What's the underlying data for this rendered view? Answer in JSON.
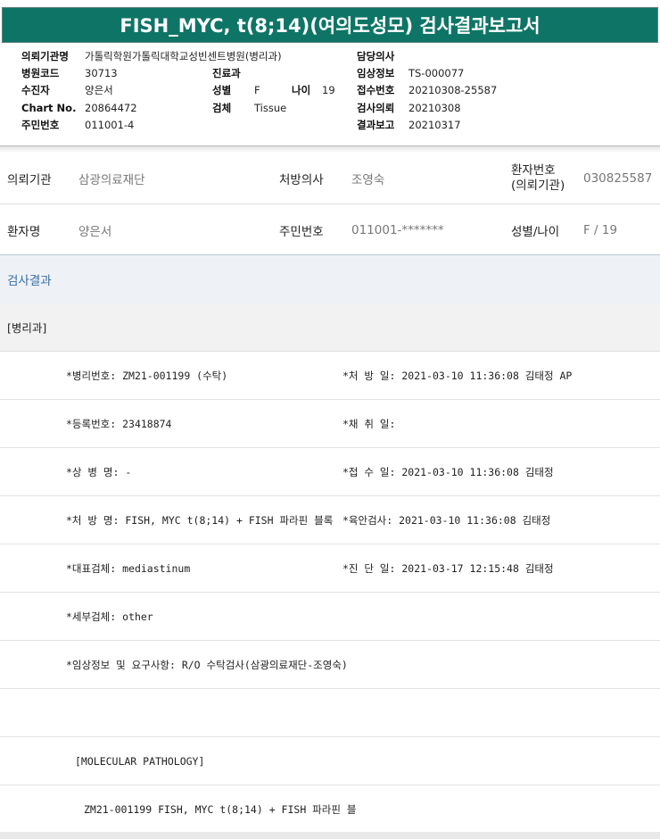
{
  "banner": {
    "title": "FISH_MYC, t(8;14)(여의도성모) 검사결과보고서"
  },
  "info": {
    "inst_label": "의뢰기관명",
    "inst_value": "가톨릭학원가톨릭대학교성빈센트병원(병리과)",
    "doctor_label": "담당의사",
    "doctor_value": "",
    "hosp_code_label": "병원코드",
    "hosp_code_value": "30713",
    "dept_label": "진료과",
    "dept_value": "",
    "clinical_label": "임상정보",
    "clinical_value": "TS-000077",
    "patient_label": "수진자",
    "patient_value": "양은서",
    "sex_label": "성별",
    "sex_value": "F",
    "age_label": "나이",
    "age_value": "19",
    "receipt_label": "접수번호",
    "receipt_value": "20210308-25587",
    "chart_label": "Chart No.",
    "chart_value": "20864472",
    "specimen_label": "검체",
    "specimen_value": "Tissue",
    "request_label": "검사의뢰",
    "request_value": "20210308",
    "rrn_label": "주민번호",
    "rrn_value": "011001-4",
    "report_label": "결과보고",
    "report_value": "20210317"
  },
  "patient_table": {
    "req_inst_label": "의뢰기관",
    "req_inst_value": "삼광의료재단",
    "presc_doc_label": "처방의사",
    "presc_doc_value": "조영숙",
    "pat_no_label": "환자번호\n(의뢰기관)",
    "pat_no_value": "030825587",
    "name_label": "환자명",
    "name_value": "양은서",
    "rrn_label": "주민번호",
    "rrn_value": "011001-*******",
    "sexage_label": "성별/나이",
    "sexage_value": "F / 19"
  },
  "result": {
    "header": "검사결과",
    "dept": "[병리과]",
    "rows": [
      {
        "left": "*병리번호: ZM21-001199 (수탁)",
        "right": "*처 방 일: 2021-03-10 11:36:08  김태정 AP"
      },
      {
        "left": "*등록번호: 23418874",
        "right": "*채 취 일:"
      },
      {
        "left": "*상 병 명: -",
        "right": "*접 수 일: 2021-03-10 11:36:08  김태정"
      },
      {
        "left": "*처 방 명: FISH, MYC t(8;14) + FISH 파라핀 블록",
        "right": "*육안검사: 2021-03-10 11:36:08  김태정"
      },
      {
        "left": "*대표검체: mediastinum",
        "right": "*진 단 일: 2021-03-17 12:15:48  김태정"
      },
      {
        "left": "*세부검체: other",
        "right": ""
      },
      {
        "left": "*임상정보 및 요구사항: R/O 수탁검사(삼광의료재단-조영숙)",
        "right": ""
      },
      {
        "left": "",
        "right": ""
      }
    ],
    "mol_header": "[MOLECULAR PATHOLOGY]",
    "mol_line": "ZM21-001199    FISH, MYC t(8;14) + FISH 파라핀 블"
  }
}
